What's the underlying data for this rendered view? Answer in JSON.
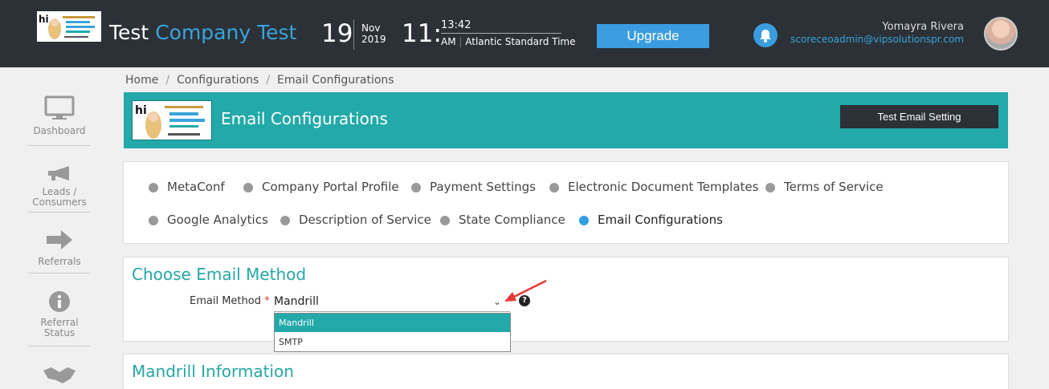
{
  "header": {
    "company_plain": "Test",
    "company_accent": "Company Test",
    "date_day": "19",
    "date_month": "Nov",
    "date_year": "2019",
    "time_hour": "11:",
    "time_minute": "13:42",
    "time_ampm": "AM",
    "timezone": "Atlantic Standard Time",
    "upgrade_label": "Upgrade",
    "user_name": "Yomayra Rivera",
    "user_email": "scoreceoadmin@vipsolutionspr.com"
  },
  "sidebar": {
    "items": [
      {
        "label": "Dashboard",
        "icon": "monitor-icon"
      },
      {
        "label": "Leads / Consumers",
        "icon": "megaphone-icon"
      },
      {
        "label": "Referrals",
        "icon": "arrow-right-icon"
      },
      {
        "label": "Referral Status",
        "icon": "info-icon"
      },
      {
        "label": "",
        "icon": "handshake-icon"
      }
    ]
  },
  "breadcrumb": [
    "Home",
    "Configurations",
    "Email Configurations"
  ],
  "banner": {
    "title": "Email Configurations",
    "test_button": "Test Email Setting"
  },
  "tabs": [
    {
      "label": "MetaConf",
      "active": false
    },
    {
      "label": "Company Portal Profile",
      "active": false
    },
    {
      "label": "Payment Settings",
      "active": false
    },
    {
      "label": "Electronic Document Templates",
      "active": false
    },
    {
      "label": "Terms of Service",
      "active": false
    },
    {
      "label": "Google Analytics",
      "active": false
    },
    {
      "label": "Description of Service",
      "active": false
    },
    {
      "label": "State Compliance",
      "active": false
    },
    {
      "label": "Email Configurations",
      "active": true
    }
  ],
  "email_method": {
    "section_title": "Choose Email Method",
    "label": "Email Method",
    "required_mark": "*",
    "value": "Mandrill",
    "options": [
      "Mandrill",
      "SMTP"
    ],
    "help": "?"
  },
  "mandrill": {
    "section_title": "Mandrill Information"
  },
  "colors": {
    "header_bg": "#2b3137",
    "teal": "#23a9a9",
    "blue": "#3b9de0",
    "arrow_red": "#e53935"
  }
}
